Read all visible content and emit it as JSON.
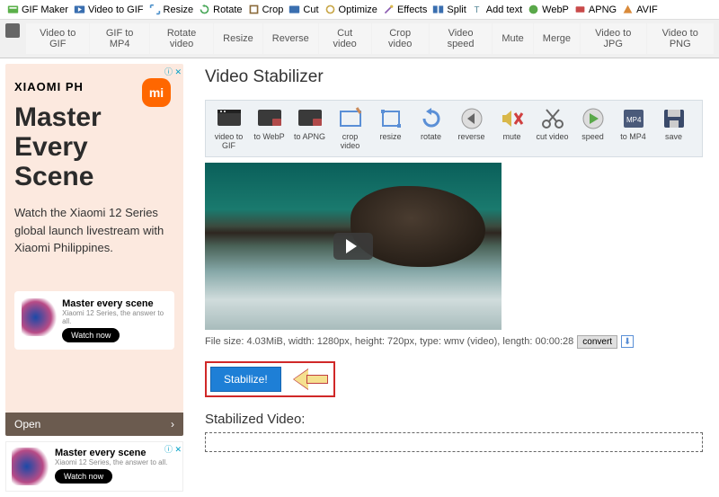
{
  "topnav": [
    {
      "label": "GIF Maker"
    },
    {
      "label": "Video to GIF"
    },
    {
      "label": "Resize"
    },
    {
      "label": "Rotate"
    },
    {
      "label": "Crop"
    },
    {
      "label": "Cut"
    },
    {
      "label": "Optimize"
    },
    {
      "label": "Effects"
    },
    {
      "label": "Split"
    },
    {
      "label": "Add text"
    },
    {
      "label": "WebP"
    },
    {
      "label": "APNG"
    },
    {
      "label": "AVIF"
    }
  ],
  "tabs": [
    "Video to GIF",
    "GIF to MP4",
    "Rotate video",
    "Resize",
    "Reverse",
    "Cut video",
    "Crop video",
    "Video speed",
    "Mute",
    "Merge",
    "Video to JPG",
    "Video to PNG"
  ],
  "page_title": "Video Stabilizer",
  "tools": [
    {
      "label": "video to GIF"
    },
    {
      "label": "to WebP"
    },
    {
      "label": "to APNG"
    },
    {
      "label": "crop video"
    },
    {
      "label": "resize"
    },
    {
      "label": "rotate"
    },
    {
      "label": "reverse"
    },
    {
      "label": "mute"
    },
    {
      "label": "cut video"
    },
    {
      "label": "speed"
    },
    {
      "label": "to MP4"
    },
    {
      "label": "save"
    }
  ],
  "fileinfo_text": "File size: 4.03MiB, width: 1280px, height: 720px, type: wmv (video), length: 00:00:28",
  "convert_label": "convert",
  "stabilize_label": "Stabilize!",
  "stabilized_heading": "Stabilized Video:",
  "ad": {
    "close": "ⓘ ✕",
    "brand": "XIAOMI PH",
    "headline": "Master Every Scene",
    "text": "Watch the Xiaomi 12 Series global launch livestream with Xiaomi Philippines.",
    "banner_title": "Master every scene",
    "banner_sub": "Xiaomi 12 Series, the answer to all.",
    "banner_btn": "Watch now",
    "open": "Open",
    "arrow": "›"
  }
}
